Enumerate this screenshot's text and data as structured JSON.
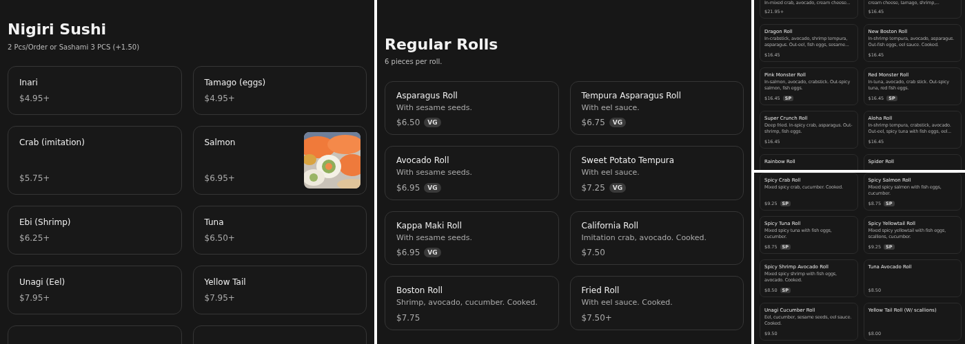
{
  "panels": [
    {
      "kind": "full",
      "title": "Nigiri Sushi",
      "subtitle": "2 Pcs/Order or Sashami 3 PCS (+1.50)",
      "items": [
        {
          "name": "Inari",
          "price": "$4.95+"
        },
        {
          "name": "Tamago (eggs)",
          "price": "$4.95+"
        },
        {
          "name": "Crab (imitation)",
          "price": "$5.75+"
        },
        {
          "name": "Salmon",
          "price": "$6.95+"
        },
        {
          "name": "Ebi (Shrimp)",
          "price": "$6.25+"
        },
        {
          "name": "Tuna",
          "price": "$6.50+"
        },
        {
          "name": "Unagi (Eel)",
          "price": "$7.95+"
        },
        {
          "name": "Yellow Tail",
          "price": "$7.95+"
        },
        {
          "kind": "cut"
        },
        {
          "kind": "cut"
        }
      ]
    },
    {
      "kind": "full",
      "title": "Regular Rolls",
      "subtitle": "6 pieces per roll.",
      "items": [
        {
          "name": "Asparagus Roll",
          "description": "With sesame seeds.",
          "price": "$6.50",
          "tag": "VG"
        },
        {
          "name": "Tempura Asparagus Roll",
          "description": "With eel sauce.",
          "price": "$6.75",
          "tag": "VG"
        },
        {
          "name": "Avocado Roll",
          "description": "With sesame seeds.",
          "price": "$6.95",
          "tag": "VG"
        },
        {
          "name": "Sweet Potato Tempura",
          "description": "With eel sauce.",
          "price": "$7.25",
          "tag": "VG"
        },
        {
          "name": "Kappa Maki Roll",
          "description": "With sesame seeds.",
          "price": "$6.95",
          "tag": "VG"
        },
        {
          "name": "California Roll",
          "description": "Imitation crab, avocado. Cooked.",
          "price": "$7.50"
        },
        {
          "name": "Boston Roll",
          "description": "Shrimp, avocado, cucumber. Cooked.",
          "price": "$7.75"
        },
        {
          "name": "Fried Roll",
          "description": "With eel sauce. Cooked.",
          "price": "$7.50+"
        }
      ]
    },
    {
      "kind": "compact",
      "items": [
        {
          "description": "In-mixed crab, avocado, cream cheese...",
          "price": "$21.95+"
        },
        {
          "description": "cream cheese, tamago, shrimp,...",
          "price": "$16.45"
        },
        {
          "name": "Dragon Roll",
          "description": "In-crabstick, avocado, shrimp tempura, asparagus. Out-eel, fish eggs, sesame...",
          "price": "$16.45"
        },
        {
          "name": "New Boston Roll",
          "description": "In-shrimp tempura, avocado, asparagus. Out-fish eggs, eel sauce. Cooked.",
          "price": "$16.45"
        },
        {
          "name": "Pink Monster Roll",
          "description": "In-salmon, avocado, crabstick. Out-spicy salmon, fish eggs.",
          "price": "$16.45",
          "tag": "SP"
        },
        {
          "name": "Red Monster Roll",
          "description": "In-tuna, avocado, crab stick. Out-spicy tuna, red fish eggs.",
          "price": "$16.45",
          "tag": "SP"
        },
        {
          "name": "Super Crunch Roll",
          "description": "Deep fried. In-spicy crab, asparagus. Out-shrimp, fish eggs.",
          "price": "$16.45"
        },
        {
          "name": "Aloha Roll",
          "description": "In-shrimp tempura, crabstick, avocado. Out-eel, spicy tuna with fish eggs, eel...",
          "price": "$16.45"
        },
        {
          "name": "Rainbow Roll"
        },
        {
          "name": "Spider Roll"
        }
      ]
    },
    {
      "kind": "compact",
      "items": [
        {
          "name": "Spicy Crab Roll",
          "description": "Mixed spicy crab, cucumber. Cooked.",
          "price": "$9.25",
          "tag": "SP"
        },
        {
          "name": "Spicy Salmon Roll",
          "description": "Mixed spicy salmon with fish eggs, cucumber.",
          "price": "$8.75",
          "tag": "SP"
        },
        {
          "name": "Spicy Tuna Roll",
          "description": "Mixed spicy tuna with fish eggs, cucumber.",
          "price": "$8.75",
          "tag": "SP"
        },
        {
          "name": "Spicy Yellowtail Roll",
          "description": "Mixed spicy yellowtail with fish eggs, scallions, cucumber.",
          "price": "$9.25",
          "tag": "SP"
        },
        {
          "name": "Spicy Shrimp Avocado Roll",
          "description": "Mixed spicy shrimp with fish eggs, avocado. Cooked.",
          "price": "$8.50",
          "tag": "SP"
        },
        {
          "name": "Tuna Avocado Roll",
          "price": "$8.50"
        },
        {
          "name": "Unagi Cucumber Roll",
          "description": "Eel, cucumber, sesame seeds, eel sauce. Cooked.",
          "price": "$9.50"
        },
        {
          "name": "Yellow Tail Roll (W/ scallions)",
          "price": "$8.00"
        }
      ]
    }
  ]
}
